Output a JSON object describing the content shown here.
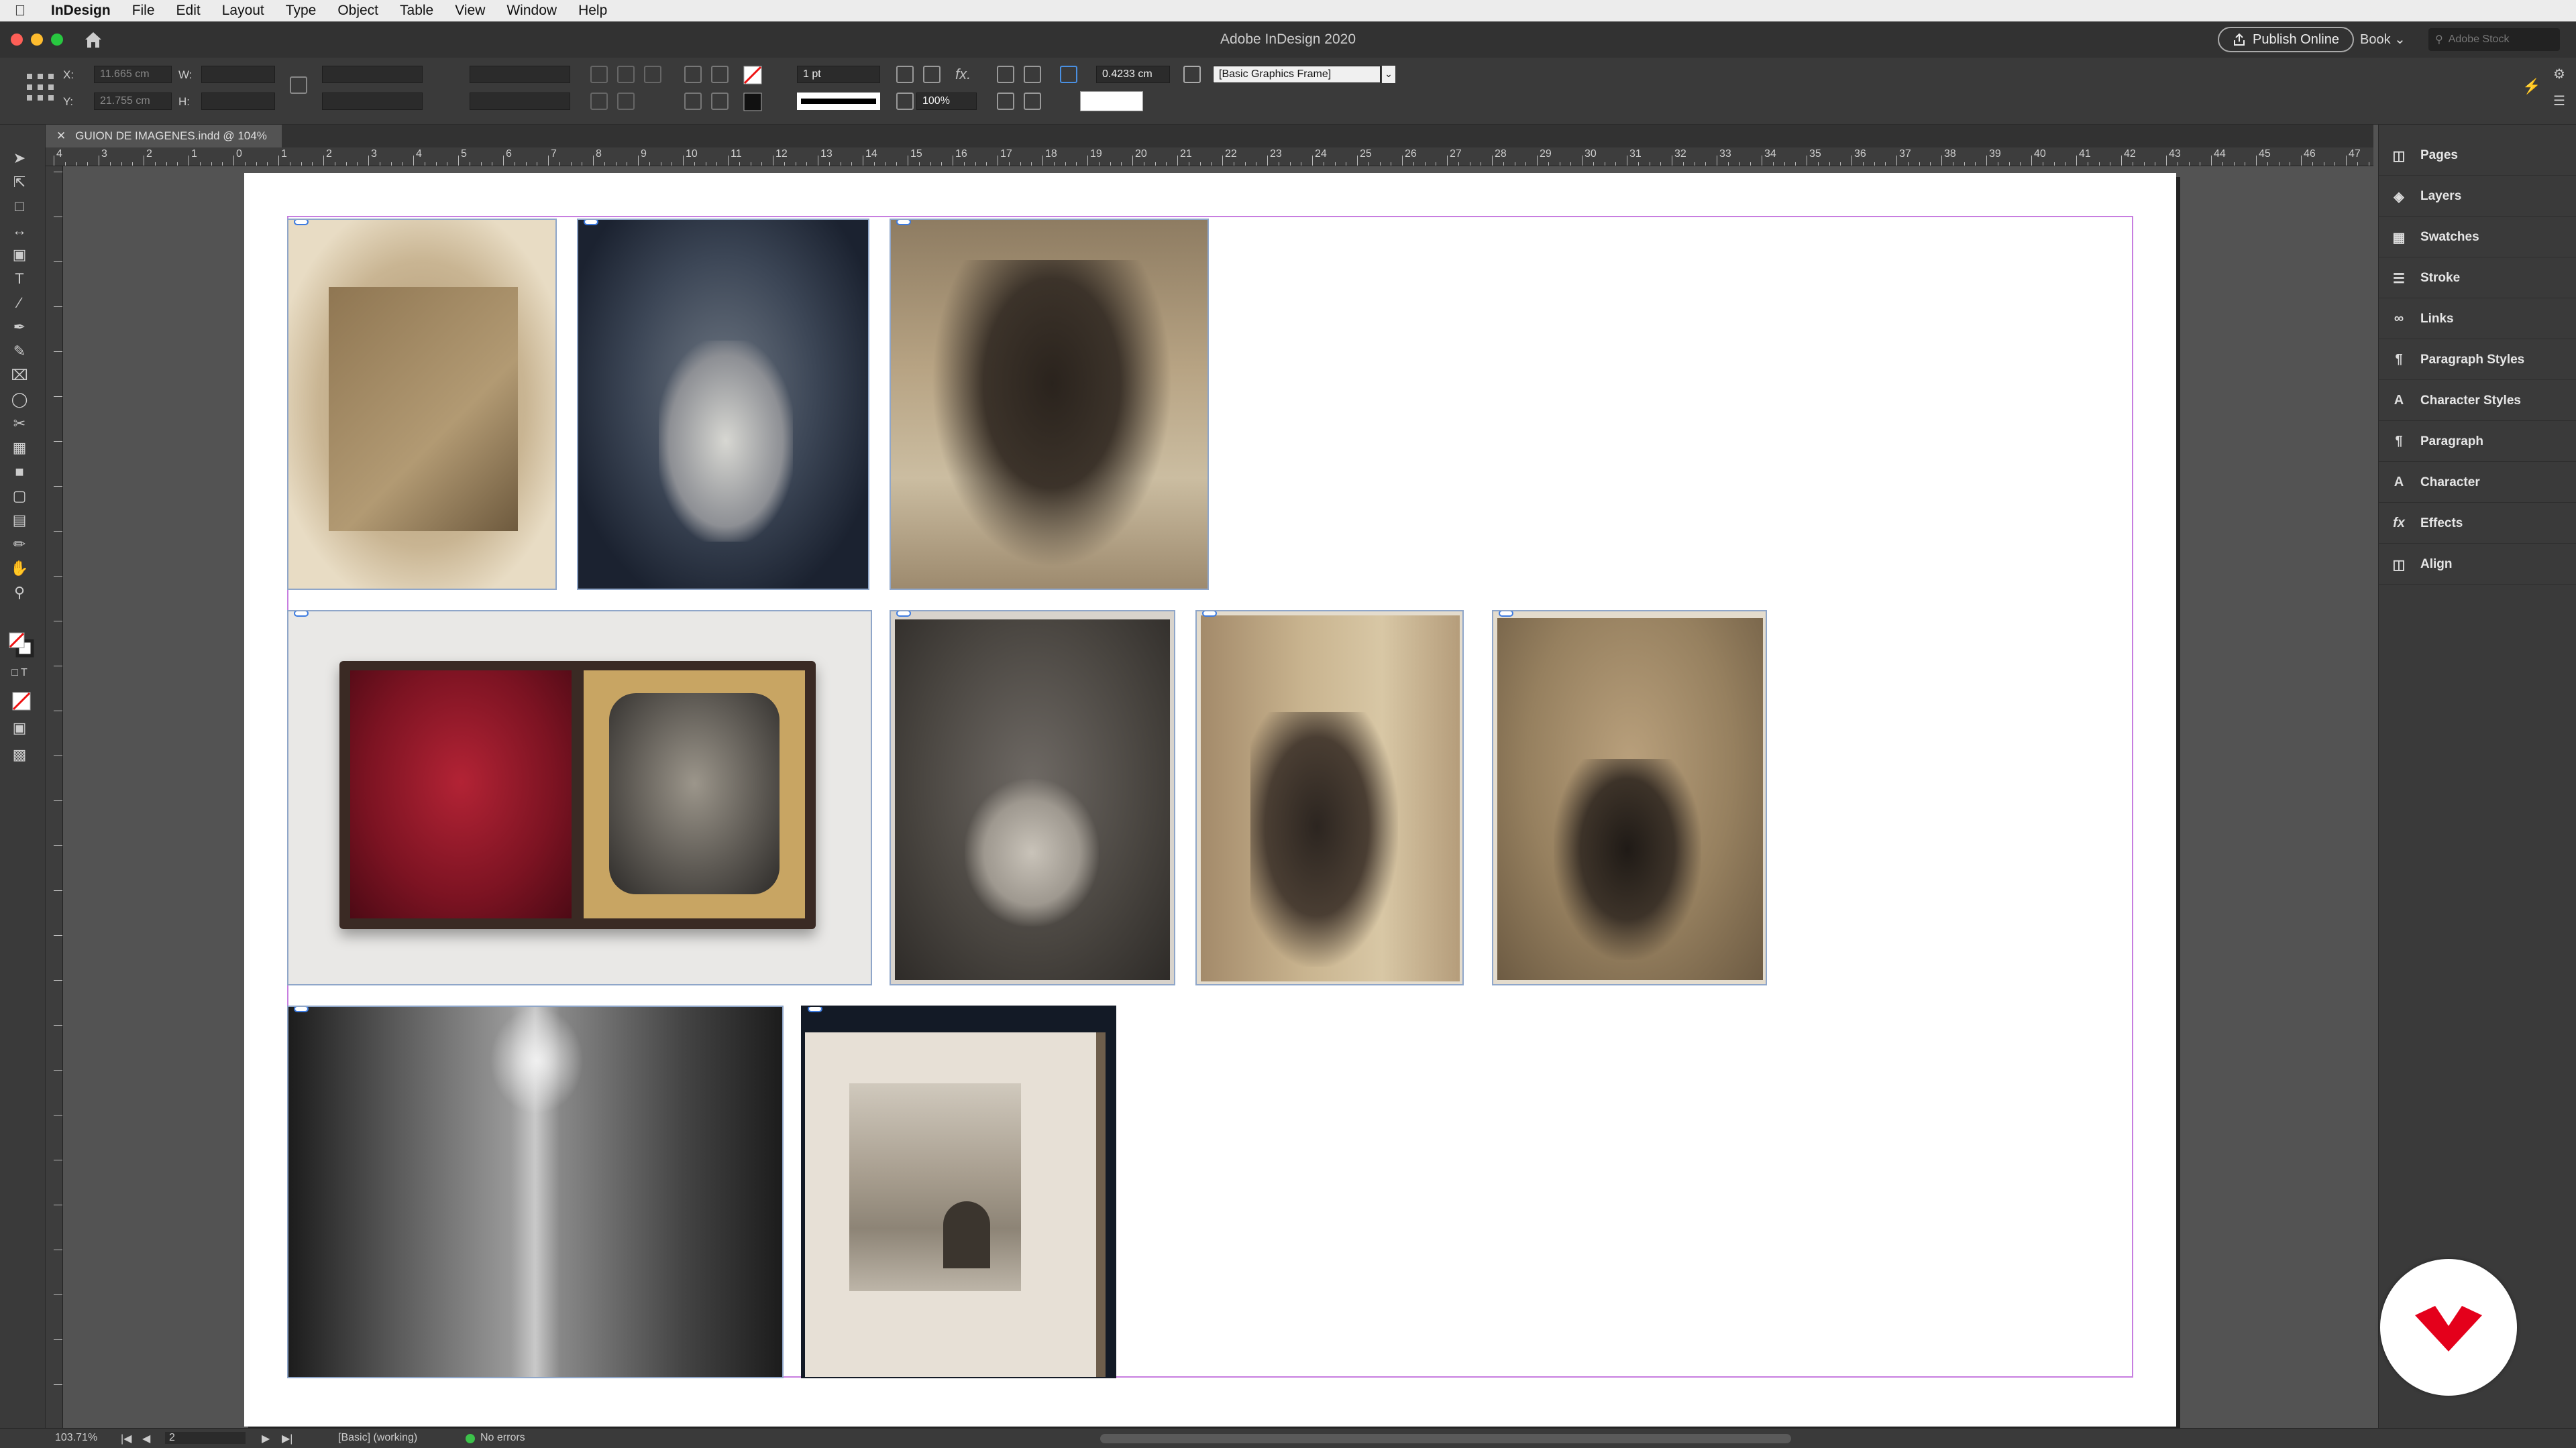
{
  "menubar": {
    "items": [
      "InDesign",
      "File",
      "Edit",
      "Layout",
      "Type",
      "Object",
      "Table",
      "View",
      "Window",
      "Help"
    ]
  },
  "titlebar": {
    "title": "Adobe InDesign 2020",
    "publish_label": "Publish Online",
    "book_label": "Book",
    "stock_placeholder": "Adobe Stock"
  },
  "control": {
    "x_label": "X:",
    "x_value": "11.665 cm",
    "y_label": "Y:",
    "y_value": "21.755 cm",
    "w_label": "W:",
    "h_label": "H:",
    "stroke_weight": "1 pt",
    "stroke_offset": "0.4233 cm",
    "opacity": "100%",
    "object_style": "[Basic Graphics Frame]"
  },
  "document": {
    "tab_title": "GUION DE IMAGENES.indd @ 104%"
  },
  "ruler": {
    "labels": [
      "4",
      "3",
      "2",
      "1",
      "0",
      "1",
      "2",
      "3",
      "4",
      "5",
      "6",
      "7",
      "8",
      "9",
      "10",
      "11",
      "12",
      "13",
      "14",
      "15",
      "16",
      "17",
      "18",
      "19",
      "20",
      "21",
      "22",
      "23",
      "24",
      "25",
      "26",
      "27",
      "28",
      "29",
      "30",
      "31",
      "32",
      "33",
      "34",
      "35",
      "36",
      "37",
      "38",
      "39",
      "40",
      "41",
      "42",
      "43",
      "44",
      "45",
      "46",
      "47"
    ]
  },
  "panels": [
    {
      "label": "Pages",
      "icon": "pages-icon"
    },
    {
      "label": "Layers",
      "icon": "layers-icon"
    },
    {
      "label": "Swatches",
      "icon": "swatches-icon"
    },
    {
      "label": "Stroke",
      "icon": "stroke-icon"
    },
    {
      "label": "Links",
      "icon": "links-icon"
    },
    {
      "label": "Paragraph Styles",
      "icon": "paragraph-styles-icon"
    },
    {
      "label": "Character Styles",
      "icon": "character-styles-icon"
    },
    {
      "label": "Paragraph",
      "icon": "paragraph-icon"
    },
    {
      "label": "Character",
      "icon": "character-icon"
    },
    {
      "label": "Effects",
      "icon": "effects-icon"
    },
    {
      "label": "Align",
      "icon": "align-icon"
    }
  ],
  "status": {
    "zoom": "103.71%",
    "page": "2",
    "profile": "[Basic] (working)",
    "preflight": "No errors"
  },
  "colors": {
    "accent": "#3d7be0",
    "guide": "#c77ee0",
    "brand": "#e4001b"
  }
}
